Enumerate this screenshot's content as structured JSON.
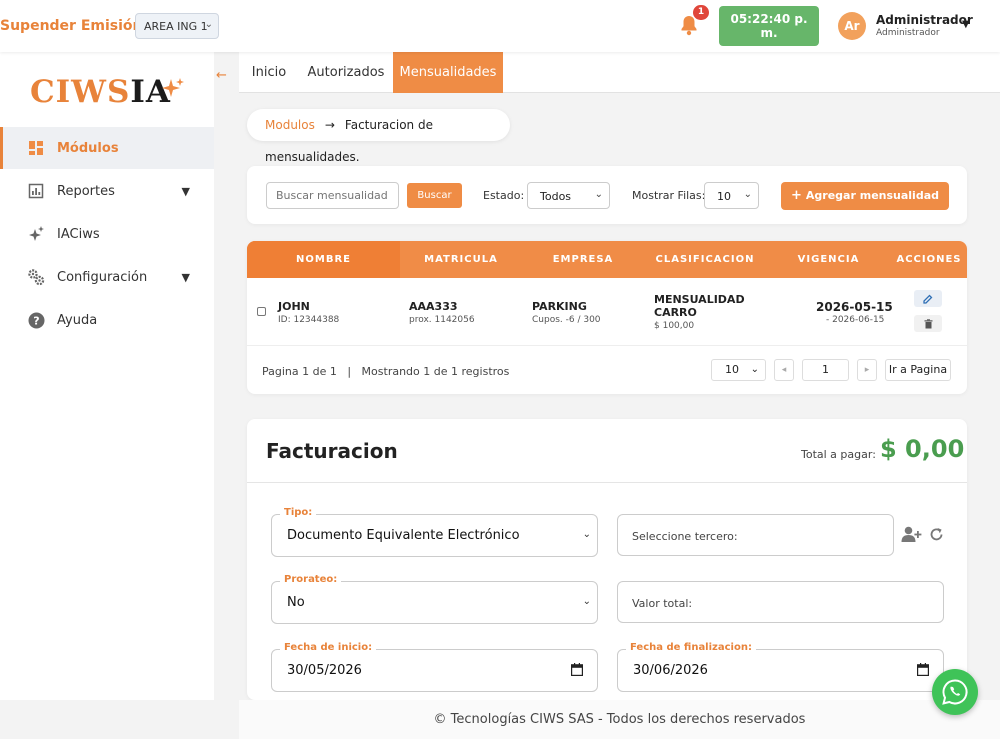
{
  "topbar": {
    "suspend_label": "Supender Emisión",
    "area_selected": "AREA ING 1",
    "notification_count": "1",
    "clock_line1": "05:22:40 p.",
    "clock_line2": "m.",
    "avatar_initials": "Ar",
    "user_name": "Administrador",
    "user_role": "Administrador"
  },
  "sidebar": {
    "logo_part1": "CIWS",
    "logo_part2": "IA",
    "items": [
      {
        "label": "Módulos",
        "icon": "grid-icon",
        "active": true
      },
      {
        "label": "Reportes",
        "icon": "chart-icon",
        "has_submenu": true
      },
      {
        "label": "IACiws",
        "icon": "sparkles-icon"
      },
      {
        "label": "Configuración",
        "icon": "gears-icon",
        "has_submenu": true
      },
      {
        "label": "Ayuda",
        "icon": "help-icon"
      }
    ]
  },
  "tabs": [
    {
      "label": "Inicio"
    },
    {
      "label": "Autorizados"
    },
    {
      "label": "Mensualidades",
      "active": true
    }
  ],
  "breadcrumb": {
    "link": "Modulos",
    "separator": "→",
    "current": "Facturacion de mensualidades."
  },
  "filters": {
    "search_placeholder": "Buscar mensualidad ...",
    "search_button": "Buscar",
    "estado_label": "Estado:",
    "estado_value": "Todos",
    "rows_label": "Mostrar Filas:",
    "rows_value": "10",
    "add_button": "Agregar mensualidad"
  },
  "table": {
    "headers": [
      "NOMBRE",
      "MATRICULA",
      "EMPRESA",
      "CLASIFICACION",
      "VIGENCIA",
      "ACCIONES"
    ],
    "rows": [
      {
        "name": "JOHN",
        "id_text": "ID: 12344388",
        "plate": "AAA333",
        "plate_sub": "prox. 1142056",
        "company": "PARKING",
        "company_sub": "Cupos. -6 / 300",
        "class_line1": "MENSUALIDAD",
        "class_line2": "CARRO",
        "class_price": "$ 100,00",
        "valid_from": "2026-05-15",
        "valid_to": "- 2026-06-15"
      }
    ],
    "pagination_text": "Pagina 1 de 1   |   Mostrando 1 de 1 registros",
    "page_size": "10",
    "page_number": "1",
    "go_to_page": "Ir a Pagina"
  },
  "facturacion": {
    "title": "Facturacion",
    "total_label": "Total a pagar:",
    "total_value": "$ 0,00",
    "tipo_label": "Tipo:",
    "tipo_value": "Documento Equivalente Electrónico",
    "tercero_placeholder": "Seleccione tercero:",
    "prorateo_label": "Prorateo:",
    "prorateo_value": "No",
    "valor_placeholder": "Valor total:",
    "inicio_label": "Fecha de inicio:",
    "inicio_value": "30/05/2026",
    "fin_label": "Fecha de finalizacion:",
    "fin_value": "30/06/2026"
  },
  "footer": {
    "text": "© Tecnologías CIWS SAS - Todos los derechos reservados"
  },
  "colors": {
    "accent": "#ef8c45",
    "success": "#4a9d4f",
    "whatsapp": "#3fc358"
  }
}
